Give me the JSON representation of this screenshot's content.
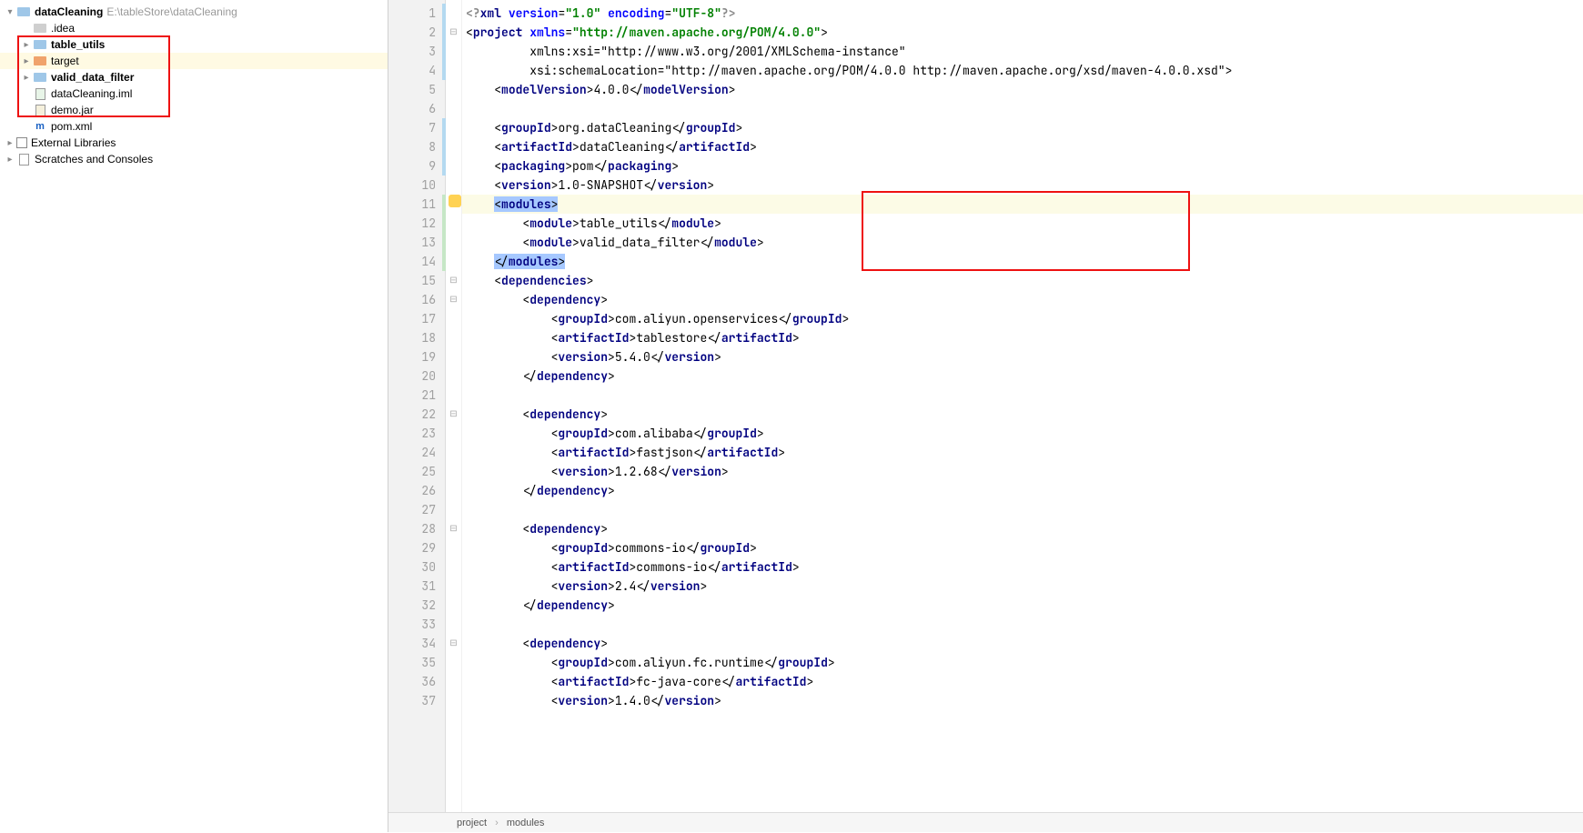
{
  "tree": {
    "root": {
      "name": "dataCleaning",
      "path": "E:\\tableStore\\dataCleaning"
    },
    "items": [
      {
        "label": ".idea",
        "kind": "grey",
        "chev": "none"
      },
      {
        "label": "table_utils",
        "kind": "mod",
        "chev": "collapsed",
        "bold": true
      },
      {
        "label": "target",
        "kind": "tgt",
        "chev": "collapsed",
        "sel": true
      },
      {
        "label": "valid_data_filter",
        "kind": "mod",
        "chev": "collapsed",
        "bold": true
      },
      {
        "label": "dataCleaning.iml",
        "kind": "iml",
        "chev": "none"
      },
      {
        "label": "demo.jar",
        "kind": "jar",
        "chev": "none"
      },
      {
        "label": "pom.xml",
        "kind": "m",
        "chev": "none"
      }
    ],
    "external": "External Libraries",
    "scratches": "Scratches and Consoles"
  },
  "code": {
    "lines": [
      "<?xml version=\"1.0\" encoding=\"UTF-8\"?>",
      "<project xmlns=\"http://maven.apache.org/POM/4.0.0\"",
      "         xmlns:xsi=\"http://www.w3.org/2001/XMLSchema-instance\"",
      "         xsi:schemaLocation=\"http://maven.apache.org/POM/4.0.0 http://maven.apache.org/xsd/maven-4.0.0.xsd\">",
      "    <modelVersion>4.0.0</modelVersion>",
      "",
      "    <groupId>org.dataCleaning</groupId>",
      "    <artifactId>dataCleaning</artifactId>",
      "    <packaging>pom</packaging>",
      "    <version>1.0-SNAPSHOT</version>",
      "    <modules>",
      "        <module>table_utils</module>",
      "        <module>valid_data_filter</module>",
      "    </modules>",
      "    <dependencies>",
      "        <dependency>",
      "            <groupId>com.aliyun.openservices</groupId>",
      "            <artifactId>tablestore</artifactId>",
      "            <version>5.4.0</version>",
      "        </dependency>",
      "",
      "        <dependency>",
      "            <groupId>com.alibaba</groupId>",
      "            <artifactId>fastjson</artifactId>",
      "            <version>1.2.68</version>",
      "        </dependency>",
      "",
      "        <dependency>",
      "            <groupId>commons-io</groupId>",
      "            <artifactId>commons-io</artifactId>",
      "            <version>2.4</version>",
      "        </dependency>",
      "",
      "        <dependency>",
      "            <groupId>com.aliyun.fc.runtime</groupId>",
      "            <artifactId>fc-java-core</artifactId>",
      "            <version>1.4.0</version>"
    ],
    "caretLine": 11,
    "selStart": 11,
    "selEnd": 14
  },
  "breadcrumb": {
    "a": "project",
    "b": "modules"
  },
  "gutterMarks": {
    "2": "m↓"
  },
  "foldMarks": [
    2,
    11,
    15,
    16,
    22,
    28,
    34
  ]
}
